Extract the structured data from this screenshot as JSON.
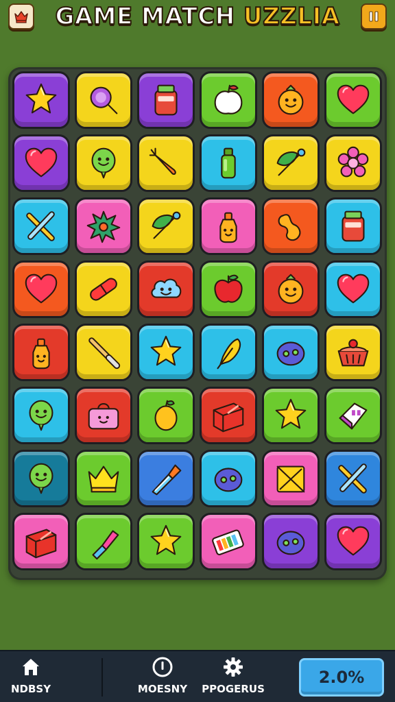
{
  "header": {
    "title_part1": "GAME MATCH ",
    "title_part2": "UZZLIA",
    "menu_icon": "crown-icon",
    "pause_icon": "pause-icon"
  },
  "board": {
    "rows": 8,
    "cols": 6,
    "tiles": [
      {
        "color": "#8a3fd6",
        "icon": "star"
      },
      {
        "color": "#f4d51c",
        "icon": "magnifier"
      },
      {
        "color": "#8a3fd6",
        "icon": "jar"
      },
      {
        "color": "#6ccb2e",
        "icon": "apple-slice"
      },
      {
        "color": "#f4591f",
        "icon": "smiley-fruit"
      },
      {
        "color": "#6ccb2e",
        "icon": "heart"
      },
      {
        "color": "#8a3fd6",
        "icon": "heart"
      },
      {
        "color": "#f4d51c",
        "icon": "balloon-face"
      },
      {
        "color": "#f4d51c",
        "icon": "carrot"
      },
      {
        "color": "#2ec0e8",
        "icon": "bottle"
      },
      {
        "color": "#f4d51c",
        "icon": "leaf-brush"
      },
      {
        "color": "#f4d51c",
        "icon": "flower"
      },
      {
        "color": "#2ec0e8",
        "icon": "crossed-sticks"
      },
      {
        "color": "#f25fb8",
        "icon": "splat"
      },
      {
        "color": "#f4d51c",
        "icon": "leaf-brush"
      },
      {
        "color": "#f25fb8",
        "icon": "bottle-face"
      },
      {
        "color": "#f4591f",
        "icon": "peanut"
      },
      {
        "color": "#2ec0e8",
        "icon": "jar"
      },
      {
        "color": "#f4591f",
        "icon": "heart"
      },
      {
        "color": "#f4d51c",
        "icon": "capsule"
      },
      {
        "color": "#e33a2a",
        "icon": "cloud-face"
      },
      {
        "color": "#6ccb2e",
        "icon": "apple"
      },
      {
        "color": "#e33a2a",
        "icon": "smiley-fruit"
      },
      {
        "color": "#2ec0e8",
        "icon": "heart"
      },
      {
        "color": "#e33a2a",
        "icon": "bottle-face"
      },
      {
        "color": "#f4d51c",
        "icon": "brush"
      },
      {
        "color": "#2ec0e8",
        "icon": "star"
      },
      {
        "color": "#2ec0e8",
        "icon": "feather"
      },
      {
        "color": "#2ec0e8",
        "icon": "blob-eyes"
      },
      {
        "color": "#f4d51c",
        "icon": "cake"
      },
      {
        "color": "#2ec0e8",
        "icon": "balloon-face"
      },
      {
        "color": "#e33a2a",
        "icon": "bag"
      },
      {
        "color": "#6ccb2e",
        "icon": "lemon"
      },
      {
        "color": "#e33a2a",
        "icon": "box"
      },
      {
        "color": "#6ccb2e",
        "icon": "star"
      },
      {
        "color": "#6ccb2e",
        "icon": "eraser"
      },
      {
        "color": "#167b9a",
        "icon": "balloon-face"
      },
      {
        "color": "#6ccb2e",
        "icon": "crown"
      },
      {
        "color": "#3b7ee0",
        "icon": "paint-brush"
      },
      {
        "color": "#2ec0e8",
        "icon": "blob-eyes"
      },
      {
        "color": "#f25fb8",
        "icon": "note-box"
      },
      {
        "color": "#2f86dd",
        "icon": "crossed-sticks"
      },
      {
        "color": "#f25fb8",
        "icon": "box"
      },
      {
        "color": "#6ccb2e",
        "icon": "lipstick"
      },
      {
        "color": "#6ccb2e",
        "icon": "star"
      },
      {
        "color": "#f25fb8",
        "icon": "battery"
      },
      {
        "color": "#8a3fd6",
        "icon": "blob-eyes"
      },
      {
        "color": "#8a3fd6",
        "icon": "heart"
      }
    ]
  },
  "bottom_nav": {
    "items": [
      {
        "label": "NDBSY",
        "icon": "home-icon"
      },
      {
        "label": "MOESNY",
        "icon": "info-icon"
      },
      {
        "label": "PPOGERUS",
        "icon": "gear-icon"
      }
    ],
    "progress_text": "2.0%"
  }
}
